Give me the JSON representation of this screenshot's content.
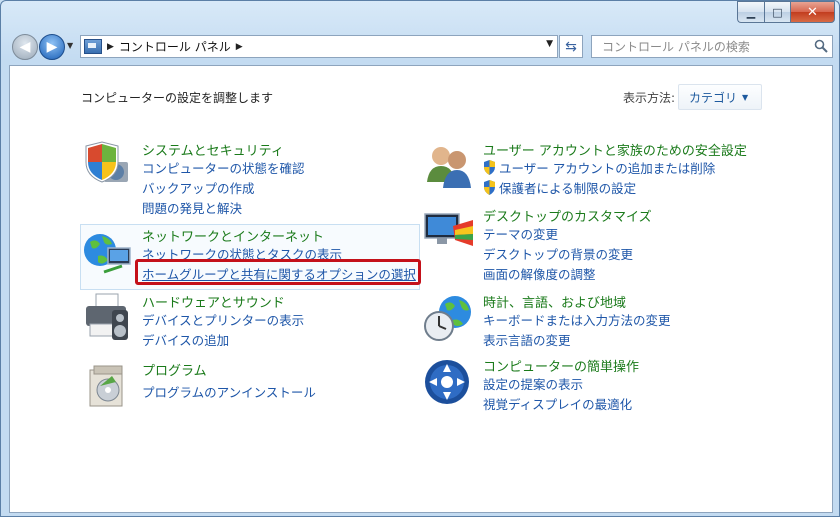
{
  "window": {
    "minimize_label": "▁",
    "maximize_label": "□",
    "close_label": "✕"
  },
  "nav": {
    "breadcrumb": [
      "コントロール パネル"
    ]
  },
  "search": {
    "placeholder": "コントロール パネルの検索"
  },
  "main": {
    "heading": "コンピューターの設定を調整します",
    "view_by_label": "表示方法:",
    "view_by_value": "カテゴリ"
  },
  "categories": {
    "system": {
      "title": "システムとセキュリティ",
      "links": [
        "コンピューターの状態を確認",
        "バックアップの作成",
        "問題の発見と解決"
      ],
      "icon": "shield-icon"
    },
    "network": {
      "title": "ネットワークとインターネット",
      "links": [
        "ネットワークの状態とタスクの表示",
        "ホームグループと共有に関するオプションの選択"
      ],
      "icon": "network-icon"
    },
    "hardware": {
      "title": "ハードウェアとサウンド",
      "links": [
        "デバイスとプリンターの表示",
        "デバイスの追加"
      ],
      "icon": "printer-icon"
    },
    "programs": {
      "title": "プログラム",
      "links": [
        "プログラムのアンインストール"
      ],
      "icon": "programs-icon"
    },
    "users": {
      "title": "ユーザー アカウントと家族のための安全設定",
      "links": [
        "ユーザー アカウントの追加または削除",
        "保護者による制限の設定"
      ],
      "icon": "users-icon"
    },
    "appearance": {
      "title": "デスクトップのカスタマイズ",
      "links": [
        "テーマの変更",
        "デスクトップの背景の変更",
        "画面の解像度の調整"
      ],
      "icon": "appearance-icon"
    },
    "clock": {
      "title": "時計、言語、および地域",
      "links": [
        "キーボードまたは入力方法の変更",
        "表示言語の変更"
      ],
      "icon": "clock-globe-icon"
    },
    "ease": {
      "title": "コンピューターの簡単操作",
      "links": [
        "設定の提案の表示",
        "視覚ディスプレイの最適化"
      ],
      "icon": "ease-of-access-icon"
    }
  },
  "colors": {
    "category_title": "#1a7a1a",
    "link": "#1e56a8",
    "highlight_border": "#c4111a"
  }
}
